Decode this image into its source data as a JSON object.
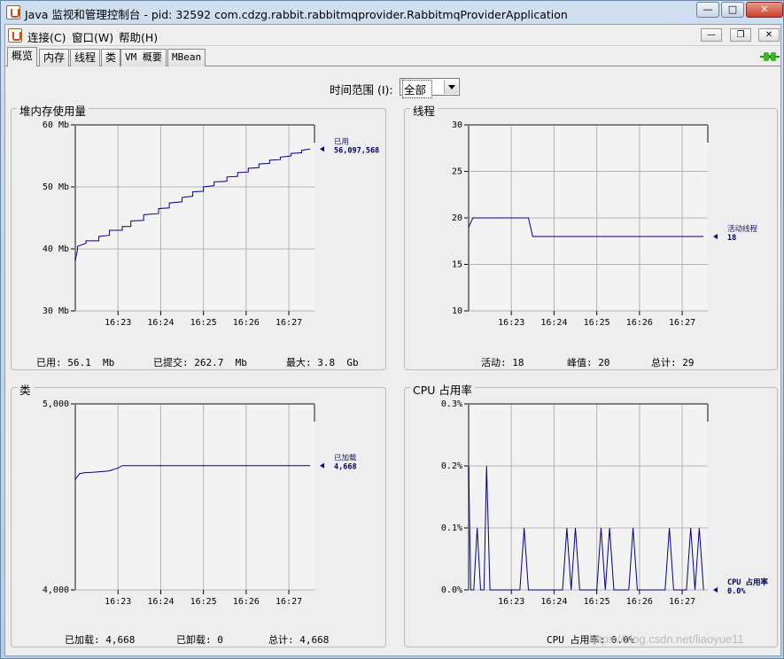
{
  "window": {
    "title": "Java 监视和管理控制台 - pid: 32592 com.cdzg.rabbit.rabbitmqprovider.RabbitmqProviderApplication"
  },
  "menu": {
    "connect": "连接(C)",
    "window": "窗口(W)",
    "help": "帮助(H)"
  },
  "tabs": [
    "概览",
    "内存",
    "线程",
    "类",
    "VM 概要",
    "MBean"
  ],
  "active_tab": "概览",
  "range": {
    "label": "时间范围 (I):",
    "value": "全部"
  },
  "heap": {
    "title": "堆内存使用量",
    "stats": {
      "used_label": "已用:",
      "used_value": "56.1  Mb",
      "committed_label": "已提交:",
      "committed_value": "262.7  Mb",
      "max_label": "最大:",
      "max_value": "3.8  Gb"
    }
  },
  "threads": {
    "title": "线程",
    "stats": {
      "live_label": "活动:",
      "live_value": "18",
      "peak_label": "峰值:",
      "peak_value": "20",
      "total_label": "总计:",
      "total_value": "29"
    }
  },
  "classes": {
    "title": "类",
    "stats": {
      "loaded_label": "已加载:",
      "loaded_value": "4,668",
      "unloaded_label": "已卸载:",
      "unloaded_value": "0",
      "total_label": "总计:",
      "total_value": "4,668"
    }
  },
  "cpu": {
    "title": "CPU 占用率",
    "stats": {
      "usage_label": "CPU 占用率:",
      "usage_value": "0.0%"
    }
  },
  "watermark": "https://blog.csdn.net/liaoyue11",
  "chart_data": [
    {
      "id": "heap",
      "type": "line",
      "title": "堆内存使用量",
      "ylim": [
        30,
        60
      ],
      "yticks": [
        {
          "v": 30,
          "t": "30 Mb"
        },
        {
          "v": 40,
          "t": "40 Mb"
        },
        {
          "v": 50,
          "t": "50 Mb"
        },
        {
          "v": 60,
          "t": "60 Mb"
        }
      ],
      "xlim": [
        0,
        5.6
      ],
      "xticks": [
        {
          "v": 1,
          "t": "16:23"
        },
        {
          "v": 2,
          "t": "16:24"
        },
        {
          "v": 3,
          "t": "16:25"
        },
        {
          "v": 4,
          "t": "16:26"
        },
        {
          "v": 5,
          "t": "16:27"
        }
      ],
      "series": [
        {
          "name": "已用",
          "value_label": "56,097,568",
          "color": "#00008b",
          "x": [
            0,
            0.05,
            0.05,
            0.25,
            0.25,
            0.55,
            0.55,
            0.8,
            0.8,
            1.1,
            1.1,
            1.3,
            1.3,
            1.6,
            1.6,
            1.95,
            1.95,
            2.2,
            2.2,
            2.5,
            2.5,
            2.75,
            2.75,
            3.0,
            3.0,
            3.25,
            3.25,
            3.55,
            3.55,
            3.8,
            3.8,
            4.05,
            4.05,
            4.3,
            4.3,
            4.55,
            4.55,
            4.8,
            4.8,
            5.05,
            5.05,
            5.3,
            5.3,
            5.5
          ],
          "y": [
            38.2,
            39.8,
            40.4,
            40.9,
            41.3,
            41.3,
            42.0,
            42.2,
            43.0,
            43.0,
            43.6,
            43.6,
            44.5,
            44.6,
            45.5,
            45.7,
            46.5,
            46.6,
            47.4,
            47.6,
            48.3,
            48.5,
            49.2,
            49.3,
            50.0,
            50.2,
            50.8,
            50.9,
            51.6,
            51.7,
            52.3,
            52.4,
            53.0,
            53.1,
            53.7,
            53.8,
            54.3,
            54.4,
            54.8,
            55.0,
            55.4,
            55.5,
            55.9,
            56.1
          ]
        }
      ]
    },
    {
      "id": "threads",
      "type": "line",
      "title": "线程",
      "ylim": [
        10,
        30
      ],
      "yticks": [
        {
          "v": 10,
          "t": "10"
        },
        {
          "v": 15,
          "t": "15"
        },
        {
          "v": 20,
          "t": "20"
        },
        {
          "v": 25,
          "t": "25"
        },
        {
          "v": 30,
          "t": "30"
        }
      ],
      "xlim": [
        0,
        5.6
      ],
      "xticks": [
        {
          "v": 1,
          "t": "16:23"
        },
        {
          "v": 2,
          "t": "16:24"
        },
        {
          "v": 3,
          "t": "16:25"
        },
        {
          "v": 4,
          "t": "16:26"
        },
        {
          "v": 5,
          "t": "16:27"
        }
      ],
      "series": [
        {
          "name": "活动线程",
          "value_label": "18",
          "color": "#00008b",
          "x": [
            0,
            0.1,
            1.4,
            1.5,
            5.5
          ],
          "y": [
            19,
            20,
            20,
            18,
            18
          ]
        }
      ]
    },
    {
      "id": "classes",
      "type": "line",
      "title": "类",
      "ylim": [
        4000,
        5000
      ],
      "yticks": [
        {
          "v": 4000,
          "t": "4,000"
        },
        {
          "v": 5000,
          "t": "5,000"
        }
      ],
      "xlim": [
        0,
        5.6
      ],
      "xticks": [
        {
          "v": 1,
          "t": "16:23"
        },
        {
          "v": 2,
          "t": "16:24"
        },
        {
          "v": 3,
          "t": "16:25"
        },
        {
          "v": 4,
          "t": "16:26"
        },
        {
          "v": 5,
          "t": "16:27"
        }
      ],
      "series": [
        {
          "name": "已加载",
          "value_label": "4,668",
          "color": "#00008b",
          "x": [
            0,
            0.1,
            0.2,
            0.4,
            0.6,
            0.8,
            0.9,
            1.0,
            1.1,
            5.5
          ],
          "y": [
            4595,
            4625,
            4630,
            4632,
            4636,
            4640,
            4648,
            4655,
            4668,
            4668
          ]
        }
      ]
    },
    {
      "id": "cpu",
      "type": "line",
      "title": "CPU 占用率",
      "ylim": [
        0,
        0.3
      ],
      "yticks": [
        {
          "v": 0,
          "t": "0.0%"
        },
        {
          "v": 0.1,
          "t": "0.1%"
        },
        {
          "v": 0.2,
          "t": "0.2%"
        },
        {
          "v": 0.3,
          "t": "0.3%"
        }
      ],
      "xlim": [
        0,
        5.6
      ],
      "xticks": [
        {
          "v": 1,
          "t": "16:23"
        },
        {
          "v": 2,
          "t": "16:24"
        },
        {
          "v": 3,
          "t": "16:25"
        },
        {
          "v": 4,
          "t": "16:26"
        },
        {
          "v": 5,
          "t": "16:27"
        }
      ],
      "series": [
        {
          "name": "CPU 占用率",
          "value_label": "0.0%",
          "color": "#00008b",
          "x": [
            0,
            0.05,
            0.12,
            0.2,
            0.28,
            0.36,
            0.42,
            0.5,
            0.58,
            1.2,
            1.3,
            1.4,
            2.2,
            2.3,
            2.4,
            2.5,
            2.6,
            2.7,
            3.0,
            3.1,
            3.2,
            3.3,
            3.4,
            3.5,
            3.75,
            3.85,
            3.95,
            4.6,
            4.7,
            4.8,
            5.1,
            5.2,
            5.3,
            5.4,
            5.5
          ],
          "y": [
            0.2,
            0.0,
            0.0,
            0.1,
            0.0,
            0.0,
            0.2,
            0.0,
            0.0,
            0.0,
            0.1,
            0.0,
            0.0,
            0.1,
            0.0,
            0.1,
            0.0,
            0.0,
            0.0,
            0.1,
            0.0,
            0.1,
            0.0,
            0.0,
            0.0,
            0.1,
            0.0,
            0.0,
            0.1,
            0.0,
            0.0,
            0.1,
            0.0,
            0.1,
            0.0
          ]
        }
      ]
    }
  ]
}
